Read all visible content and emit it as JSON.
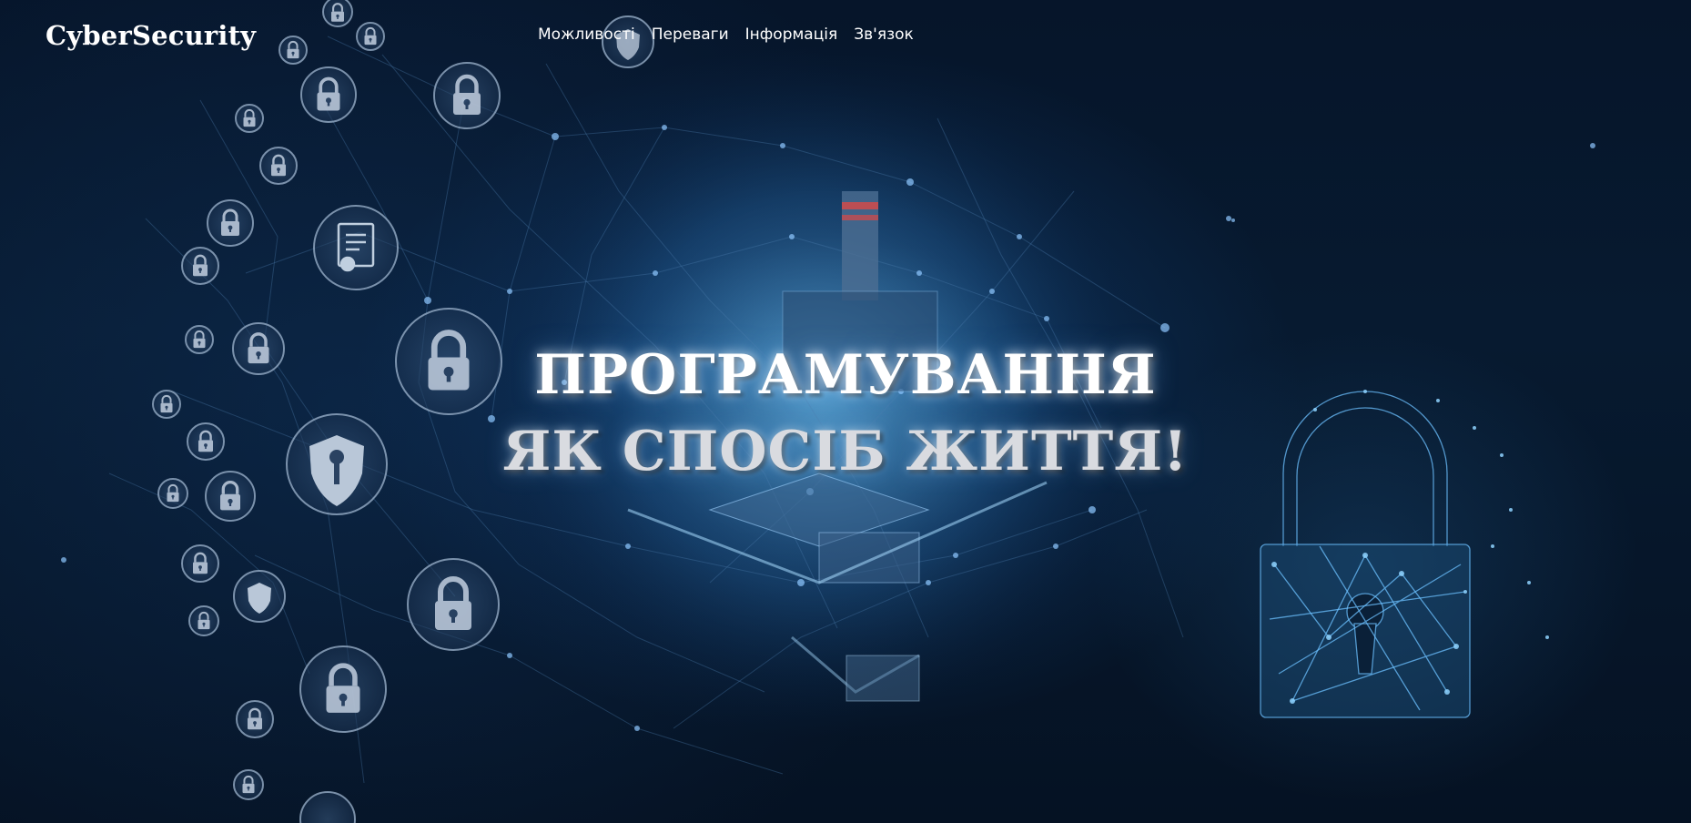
{
  "header": {
    "logo": "CyberSecurity",
    "nav": [
      {
        "label": "Можливості"
      },
      {
        "label": "Переваги"
      },
      {
        "label": "Інформація"
      },
      {
        "label": "Зв'язок"
      }
    ]
  },
  "hero": {
    "line1": "ПРОГРАМУВАННЯ",
    "line2": "ЯК СПОСІБ ЖИТТЯ!"
  },
  "background": {
    "theme_colors": {
      "base": "#04101f",
      "glow": "#3a8fd6",
      "icon_stroke": "#9fb6cf",
      "lock_network": "#5fb4ee"
    },
    "icons": [
      "padlock-icon",
      "shield-key-icon",
      "certificate-icon",
      "shield-icon",
      "network-padlock-icon",
      "globe-network-icon"
    ]
  }
}
